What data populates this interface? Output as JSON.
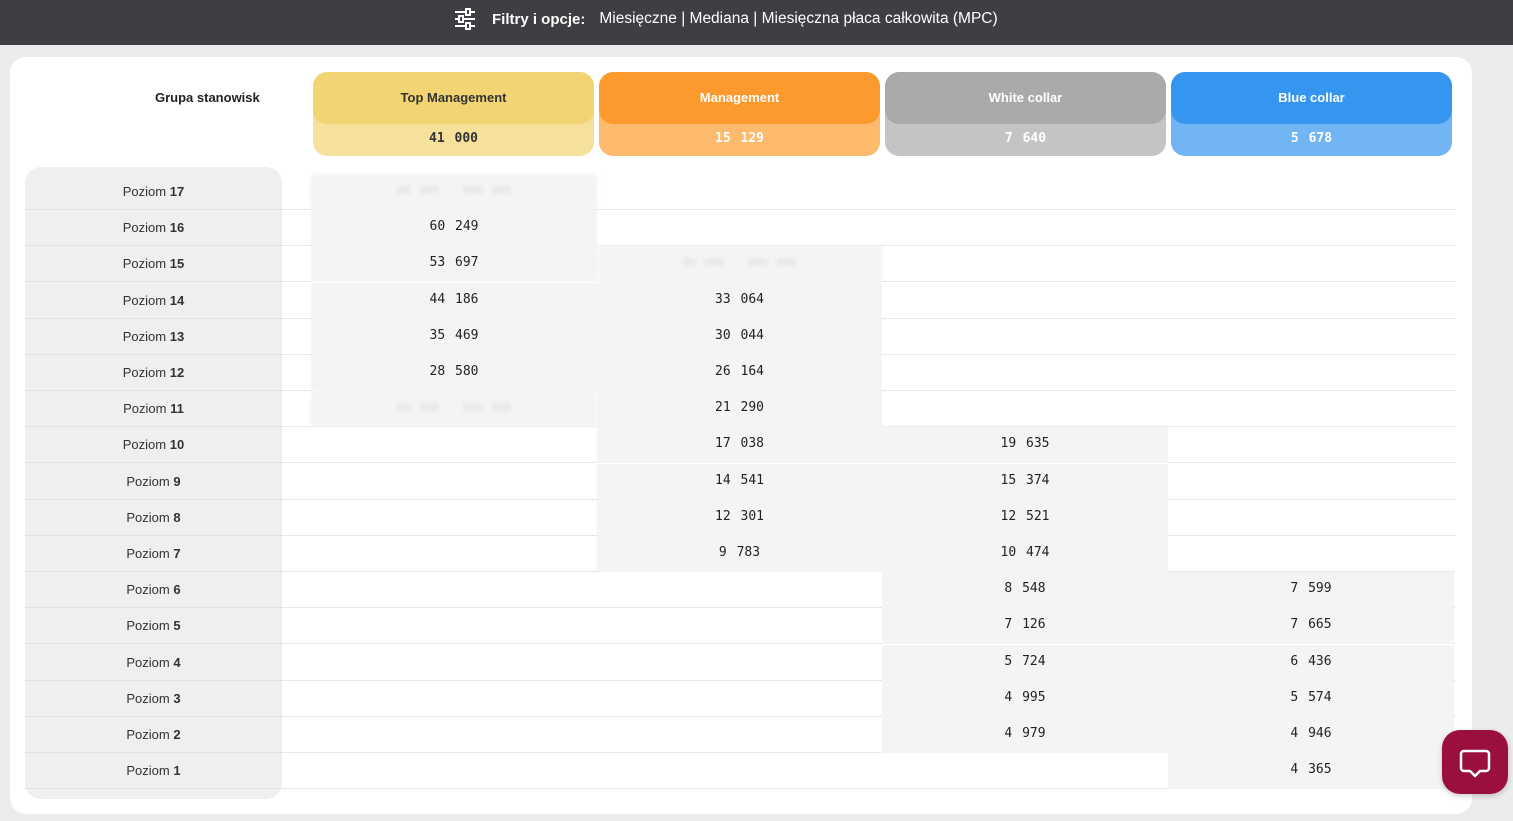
{
  "filters": {
    "label": "Filtry i opcje:",
    "values": "Miesięczne | Mediana | Miesięczna płaca całkowita (MPC)"
  },
  "table": {
    "group_label": "Grupa stanowisk",
    "columns": [
      {
        "name": "Top Management",
        "average": "41 000",
        "header_color": "#f2d472",
        "average_color": "#f5e09c",
        "text_color": "#333333"
      },
      {
        "name": "Management",
        "average": "15 129",
        "header_color": "#fd9a2e",
        "average_color": "#fdb96c",
        "text_color": "#ffffff"
      },
      {
        "name": "White collar",
        "average": "7 640",
        "header_color": "#aaaaaa",
        "average_color": "#c4c4c4",
        "text_color": "#ffffff"
      },
      {
        "name": "Blue collar",
        "average": "5 678",
        "header_color": "#3596ef",
        "average_color": "#72b5f4",
        "text_color": "#ffffff"
      }
    ],
    "row_prefix": "Poziom",
    "rows": [
      {
        "level": "17",
        "values": [
          "blurred",
          "",
          "",
          ""
        ]
      },
      {
        "level": "16",
        "values": [
          "60 249",
          "",
          "",
          ""
        ]
      },
      {
        "level": "15",
        "values": [
          "53 697",
          "blurred",
          "",
          ""
        ]
      },
      {
        "level": "14",
        "values": [
          "44 186",
          "33 064",
          "",
          ""
        ]
      },
      {
        "level": "13",
        "values": [
          "35 469",
          "30 044",
          "",
          ""
        ]
      },
      {
        "level": "12",
        "values": [
          "28 580",
          "26 164",
          "",
          ""
        ]
      },
      {
        "level": "11",
        "values": [
          "blurred",
          "21 290",
          "",
          ""
        ]
      },
      {
        "level": "10",
        "values": [
          "",
          "17 038",
          "19 635",
          ""
        ]
      },
      {
        "level": "9",
        "values": [
          "",
          "14 541",
          "15 374",
          ""
        ]
      },
      {
        "level": "8",
        "values": [
          "",
          "12 301",
          "12 521",
          ""
        ]
      },
      {
        "level": "7",
        "values": [
          "",
          "9 783",
          "10 474",
          ""
        ]
      },
      {
        "level": "6",
        "values": [
          "",
          "",
          "8 548",
          "7 599"
        ]
      },
      {
        "level": "5",
        "values": [
          "",
          "",
          "7 126",
          "7 665"
        ]
      },
      {
        "level": "4",
        "values": [
          "",
          "",
          "5 724",
          "6 436"
        ]
      },
      {
        "level": "3",
        "values": [
          "",
          "",
          "4 995",
          "5 574"
        ]
      },
      {
        "level": "2",
        "values": [
          "",
          "",
          "4 979",
          "4 946"
        ]
      },
      {
        "level": "1",
        "values": [
          "",
          "",
          "",
          "4 365"
        ]
      }
    ],
    "blur_placeholder": "00 000 - 000 000"
  },
  "help_button": {
    "icon": "chat-bubble-icon"
  }
}
